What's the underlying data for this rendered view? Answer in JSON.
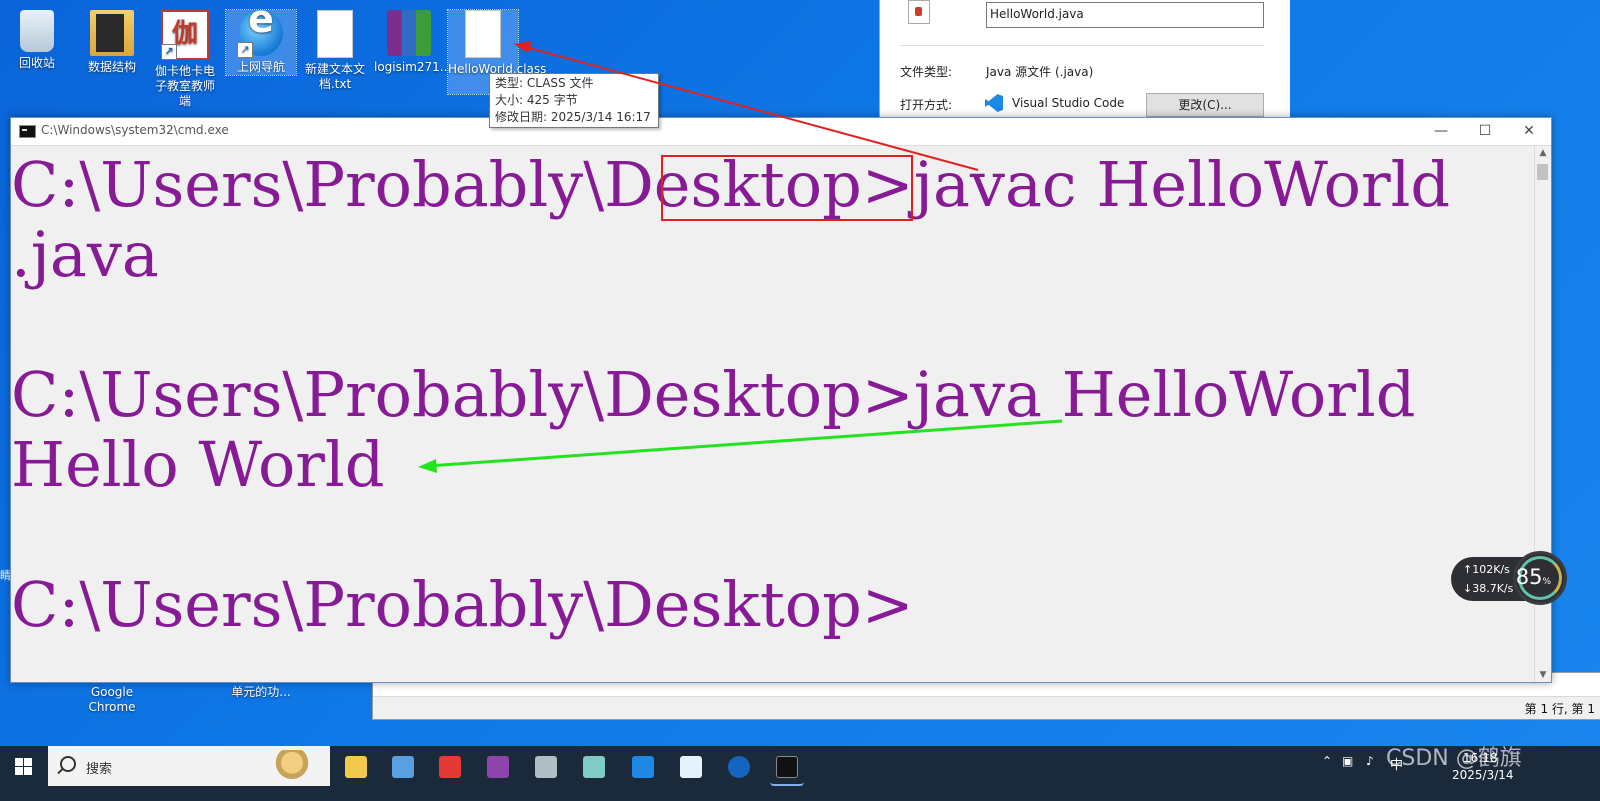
{
  "desktop": {
    "icons": [
      {
        "label": "回收站"
      },
      {
        "label": "数据结构"
      },
      {
        "label": "伽卡他卡电子教室教师端"
      },
      {
        "label": "上网导航"
      },
      {
        "label": "新建文本文档.txt"
      },
      {
        "label": "logisim271..."
      },
      {
        "label": "HelloWorld.class"
      }
    ],
    "tooltip": {
      "type": "类型: CLASS 文件",
      "size": "大小: 425 字节",
      "modified": "修改日期: 2025/3/14 16:17"
    },
    "partial_icons": [
      {
        "label": "Google Chrome"
      },
      {
        "label": "单元的功..."
      }
    ]
  },
  "properties_dialog": {
    "filename": "HelloWorld.java",
    "file_type_label": "文件类型:",
    "file_type_value": "Java 源文件 (.java)",
    "open_with_label": "打开方式:",
    "open_with_value": "Visual Studio Code",
    "change_button": "更改(C)..."
  },
  "notepad": {
    "status_position": "第 1 行, 第 1"
  },
  "cmd": {
    "title": "C:\\Windows\\system32\\cmd.exe",
    "lines": [
      "C:\\Users\\Probably\\Desktop>javac HelloWorld",
      ".java",
      "",
      "C:\\Users\\Probably\\Desktop>java HelloWorld",
      "Hello World",
      "",
      "C:\\Users\\Probably\\Desktop>"
    ],
    "text_color": "#871b96",
    "background_color": "#f0f0f0"
  },
  "annotations": {
    "highlight_color": "#e0221f",
    "green_arrow_color": "#22e31d"
  },
  "network_widget": {
    "upload": "102K/s",
    "download": "38.7K/s",
    "percent": "85",
    "percent_unit": "%"
  },
  "taskbar": {
    "search_placeholder": "搜索",
    "time": "16:18",
    "date": "2025/3/14",
    "ime": "中",
    "watermark": "CSDN @鹤旗"
  }
}
